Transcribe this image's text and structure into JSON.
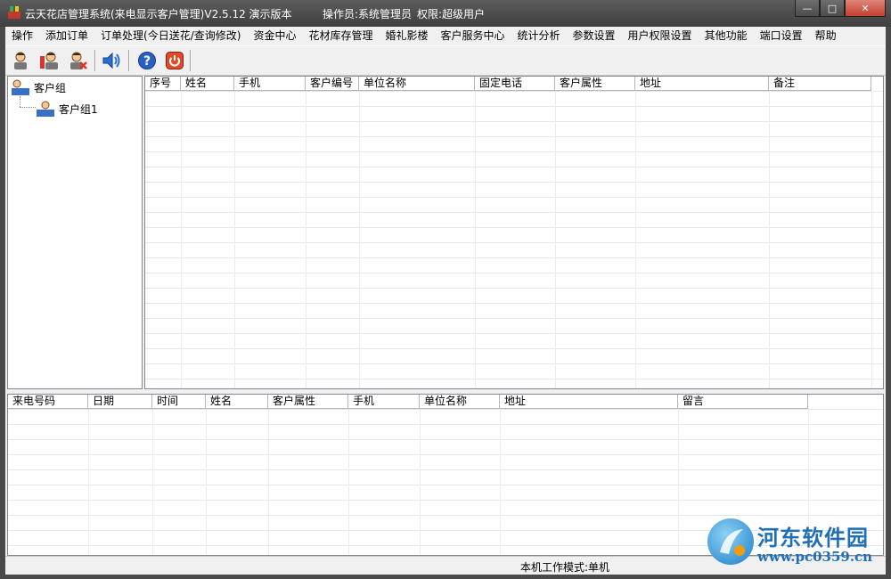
{
  "window": {
    "title": "云天花店管理系统(来电显示客户管理)V2.5.12 演示版本",
    "operator": "操作员:系统管理员",
    "permission": "权限:超级用户",
    "controls": {
      "minimize": "—",
      "maximize": "□",
      "close": "✕"
    }
  },
  "menu": {
    "items": [
      "操作",
      "添加订单",
      "订单处理(今日送花/查询修改)",
      "资金中心",
      "花材库存管理",
      "婚礼影楼",
      "客户服务中心",
      "统计分析",
      "参数设置",
      "用户权限设置",
      "其他功能",
      "端口设置",
      "帮助"
    ]
  },
  "toolbar": {
    "icons": [
      "add-customer-icon",
      "edit-customer-icon",
      "delete-customer-icon",
      "speaker-icon",
      "help-icon",
      "power-icon"
    ]
  },
  "tree": {
    "root": "客户组",
    "child": "客户组1"
  },
  "customer_grid": {
    "columns": [
      "序号",
      "姓名",
      "手机",
      "客户编号",
      "单位名称",
      "固定电话",
      "客户属性",
      "地址",
      "备注"
    ]
  },
  "calls_grid": {
    "columns": [
      "来电号码",
      "日期",
      "时间",
      "姓名",
      "客户属性",
      "手机",
      "单位名称",
      "地址",
      "留言"
    ]
  },
  "status": {
    "mode": "本机工作模式:单机"
  },
  "watermark": {
    "name": "河东软件园",
    "url": "www.pc0359.cn"
  },
  "colors": {
    "titlebar": "#4a4a4a",
    "close_button": "#c4402e",
    "help_blue": "#2a5fc4",
    "power_red": "#e04a2a",
    "watermark_blue": "#1f6fb8"
  }
}
